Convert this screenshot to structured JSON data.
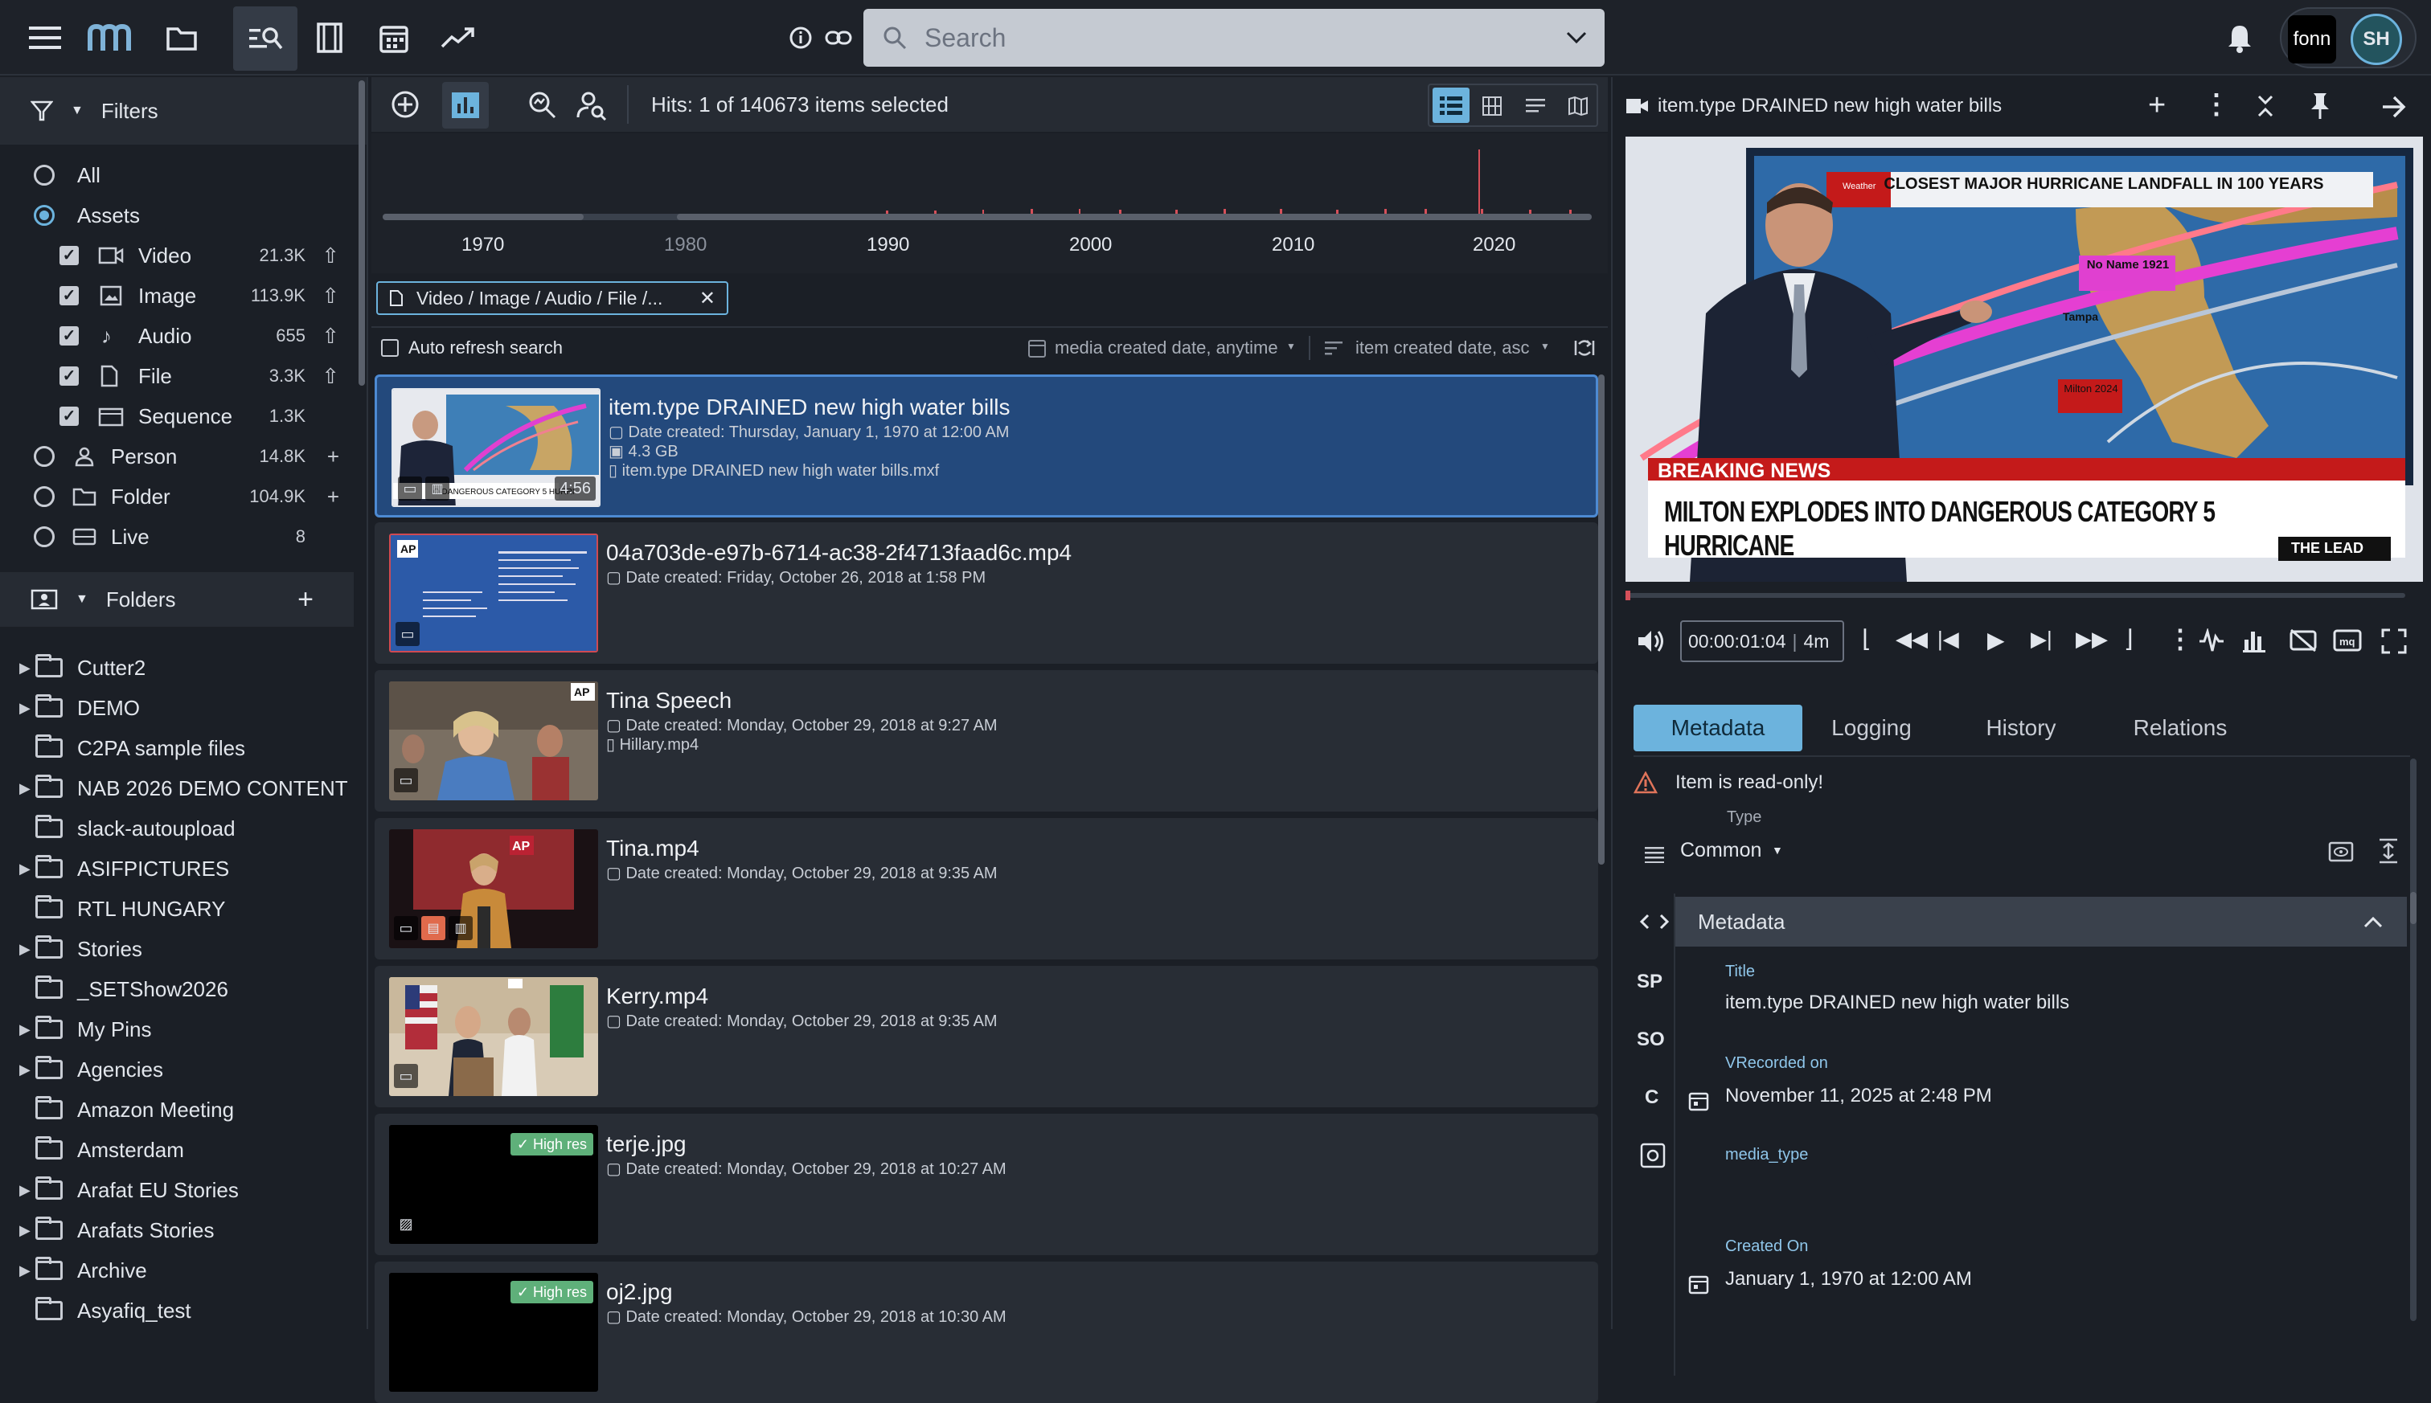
{
  "topbar": {
    "search_placeholder": "Search",
    "user_initials": "SH",
    "brand_text": "fonn"
  },
  "filters": {
    "title": "Filters",
    "items": [
      {
        "label": "All",
        "count": "",
        "type": "radio",
        "selected": false
      },
      {
        "label": "Assets",
        "count": "",
        "type": "radio",
        "selected": true
      },
      {
        "label": "Video",
        "count": "21.3K",
        "type": "check"
      },
      {
        "label": "Image",
        "count": "113.9K",
        "type": "check"
      },
      {
        "label": "Audio",
        "count": "655",
        "type": "check"
      },
      {
        "label": "File",
        "count": "3.3K",
        "type": "check"
      },
      {
        "label": "Sequence",
        "count": "1.3K",
        "type": "check"
      },
      {
        "label": "Person",
        "count": "14.8K",
        "type": "radio",
        "selected": false
      },
      {
        "label": "Folder",
        "count": "104.9K",
        "type": "radio",
        "selected": false
      },
      {
        "label": "Live",
        "count": "8",
        "type": "radio",
        "selected": false
      }
    ]
  },
  "folders": {
    "title": "Folders",
    "items": [
      "Cutter2",
      "DEMO",
      "C2PA sample files",
      "NAB 2026 DEMO CONTENT",
      "slack-autoupload",
      "ASIFPICTURES",
      "RTL HUNGARY",
      "Stories",
      "_SETShow2026",
      "My Pins",
      "Agencies",
      "Amazon Meeting",
      "Amsterdam",
      "Arafat EU Stories",
      "Arafats Stories",
      "Archive",
      "Asyafiq_test"
    ]
  },
  "results": {
    "hits": "Hits: 1 of 140673 items selected",
    "timeline_years": [
      "1970",
      "1980",
      "1990",
      "2000",
      "2010",
      "2020"
    ],
    "chip": "Video / Image / Audio / File /...",
    "auto_refresh": "Auto refresh search",
    "sort_date": "media created date, anytime",
    "sort_order": "item created date, asc",
    "items": [
      {
        "title": "item.type DRAINED new high water bills",
        "lines": [
          "Date created: Thursday, January 1, 1970 at 12:00 AM",
          "4.3 GB",
          "item.type DRAINED new high water bills.mxf"
        ],
        "duration": "4:56"
      },
      {
        "title": "04a703de-e97b-6714-ac38-2f4713faad6c.mp4",
        "lines": [
          "Date created: Friday, October 26, 2018 at 1:58 PM"
        ]
      },
      {
        "title": "Tina Speech",
        "lines": [
          "Date created: Monday, October 29, 2018 at 9:27 AM",
          "Hillary.mp4"
        ]
      },
      {
        "title": "Tina.mp4",
        "lines": [
          "Date created: Monday, October 29, 2018 at 9:35 AM"
        ]
      },
      {
        "title": "Kerry.mp4",
        "lines": [
          "Date created: Monday, October 29, 2018 at 9:35 AM"
        ]
      },
      {
        "title": "terje.jpg",
        "lines": [
          "Date created: Monday, October 29, 2018 at 10:27 AM"
        ],
        "badge": "High res"
      },
      {
        "title": "oj2.jpg",
        "lines": [
          "Date created: Monday, October 29, 2018 at 10:30 AM"
        ],
        "badge": "High res"
      }
    ]
  },
  "detail": {
    "title": "item.type DRAINED new high water bills",
    "video": {
      "banner_top": "CLOSEST MAJOR HURRICANE LANDFALL IN 100 YEARS",
      "breaking": "BREAKING NEWS",
      "headline": "MILTON EXPLODES INTO DANGEROUS CATEGORY 5 HURRICANE",
      "show": "THE LEAD",
      "map_label_1": "No Name 1921",
      "map_label_2": "Tampa",
      "map_label_3": "Milton 2024",
      "weather_tag": "Weather"
    },
    "timecode": "00:00:01:04",
    "duration": "4m",
    "tabs": [
      "Metadata",
      "Logging",
      "History",
      "Relations"
    ],
    "readonly": "Item is read-only!",
    "type_label": "Type",
    "type_value": "Common",
    "section": "Metadata",
    "side_codes": [
      "SP",
      "SO",
      "C"
    ],
    "fields": [
      {
        "label": "Title",
        "value": "item.type  DRAINED new high water bills"
      },
      {
        "label": "VRecorded on",
        "value": "November 11, 2025 at 2:48 PM"
      },
      {
        "label": "media_type",
        "value": ""
      },
      {
        "label": "Created On",
        "value": "January 1, 1970 at 12:00 AM"
      }
    ]
  }
}
